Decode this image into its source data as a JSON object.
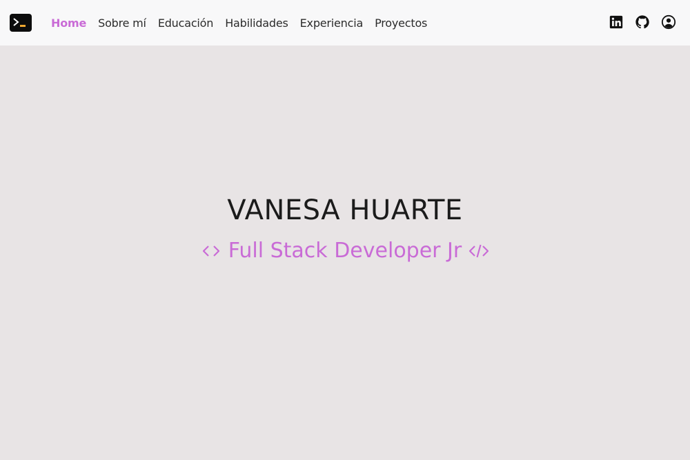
{
  "navbar": {
    "brand_icon": "terminal-icon",
    "links": [
      {
        "label": "Home",
        "active": true
      },
      {
        "label": "Sobre mí",
        "active": false
      },
      {
        "label": "Educación",
        "active": false
      },
      {
        "label": "Habilidades",
        "active": false
      },
      {
        "label": "Experiencia",
        "active": false
      },
      {
        "label": "Proyectos",
        "active": false
      }
    ],
    "icons": [
      "linkedin-icon",
      "github-icon",
      "user-circle-icon"
    ]
  },
  "hero": {
    "name": "VANESA HUARTE",
    "role": "Full Stack Developer Jr",
    "left_icon": "code-brackets-icon",
    "right_icon": "code-slash-icon"
  },
  "colors": {
    "accent": "#c96bd6",
    "page_background": "#e8e4e5",
    "navbar_background": "#f8f8f9",
    "text": "#1b1b1b"
  }
}
